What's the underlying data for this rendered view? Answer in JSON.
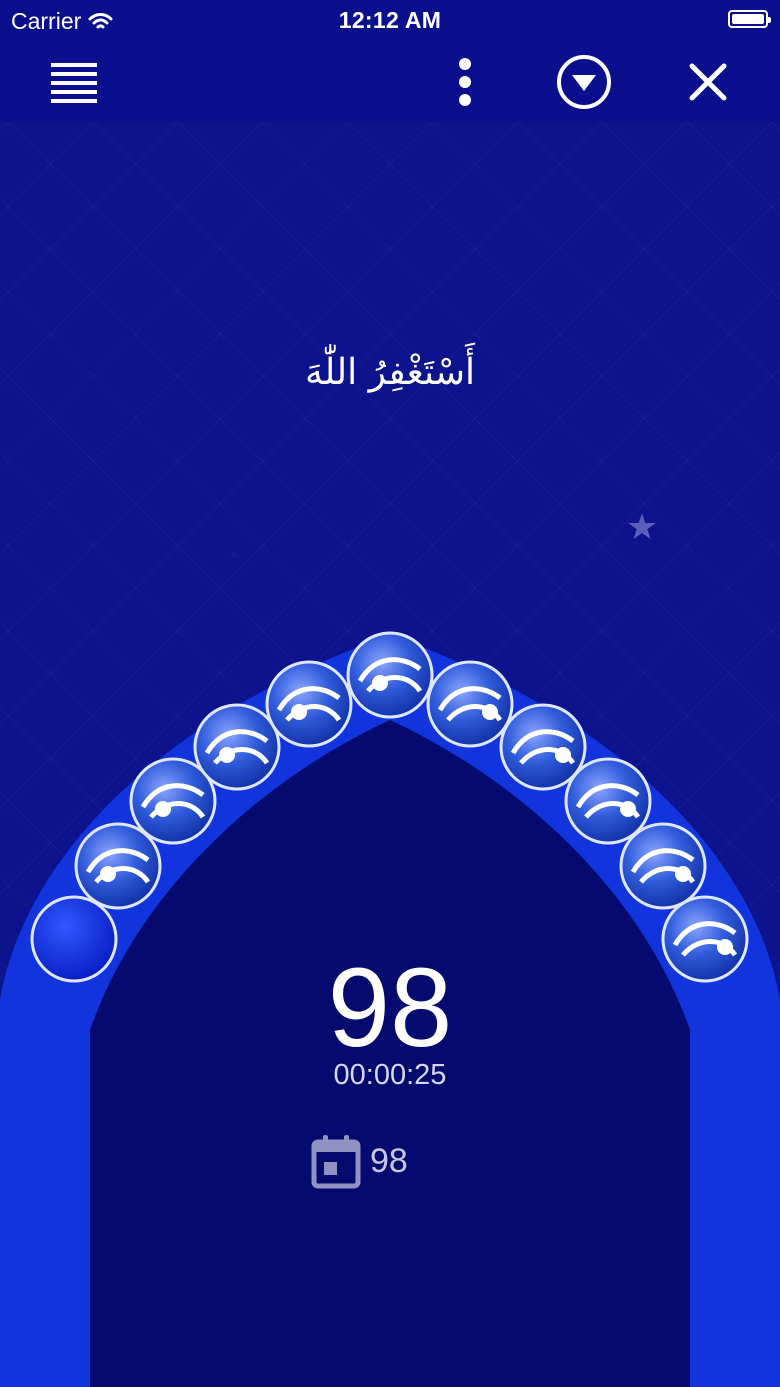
{
  "status_bar": {
    "carrier": "Carrier",
    "time": "12:12 AM",
    "wifi_icon": "wifi-icon",
    "battery_icon": "battery-icon"
  },
  "toolbar": {
    "menu_icon": "list-icon",
    "more_icon": "more-vertical-icon",
    "download_icon": "chevron-down-circle-icon",
    "close_icon": "close-icon"
  },
  "main": {
    "phrase": "أَسْتَغْفِرُ اللّٰهَ",
    "favorite_icon": "star-icon",
    "count": "98",
    "elapsed": "00:00:25",
    "daily_icon": "calendar-icon",
    "daily_count": "98"
  },
  "colors": {
    "background": "#0d138d",
    "arch_outer": "#1234dd",
    "arch_inner": "#050a6f",
    "bead_blue": "#2d56d6",
    "text": "#ffffff"
  }
}
